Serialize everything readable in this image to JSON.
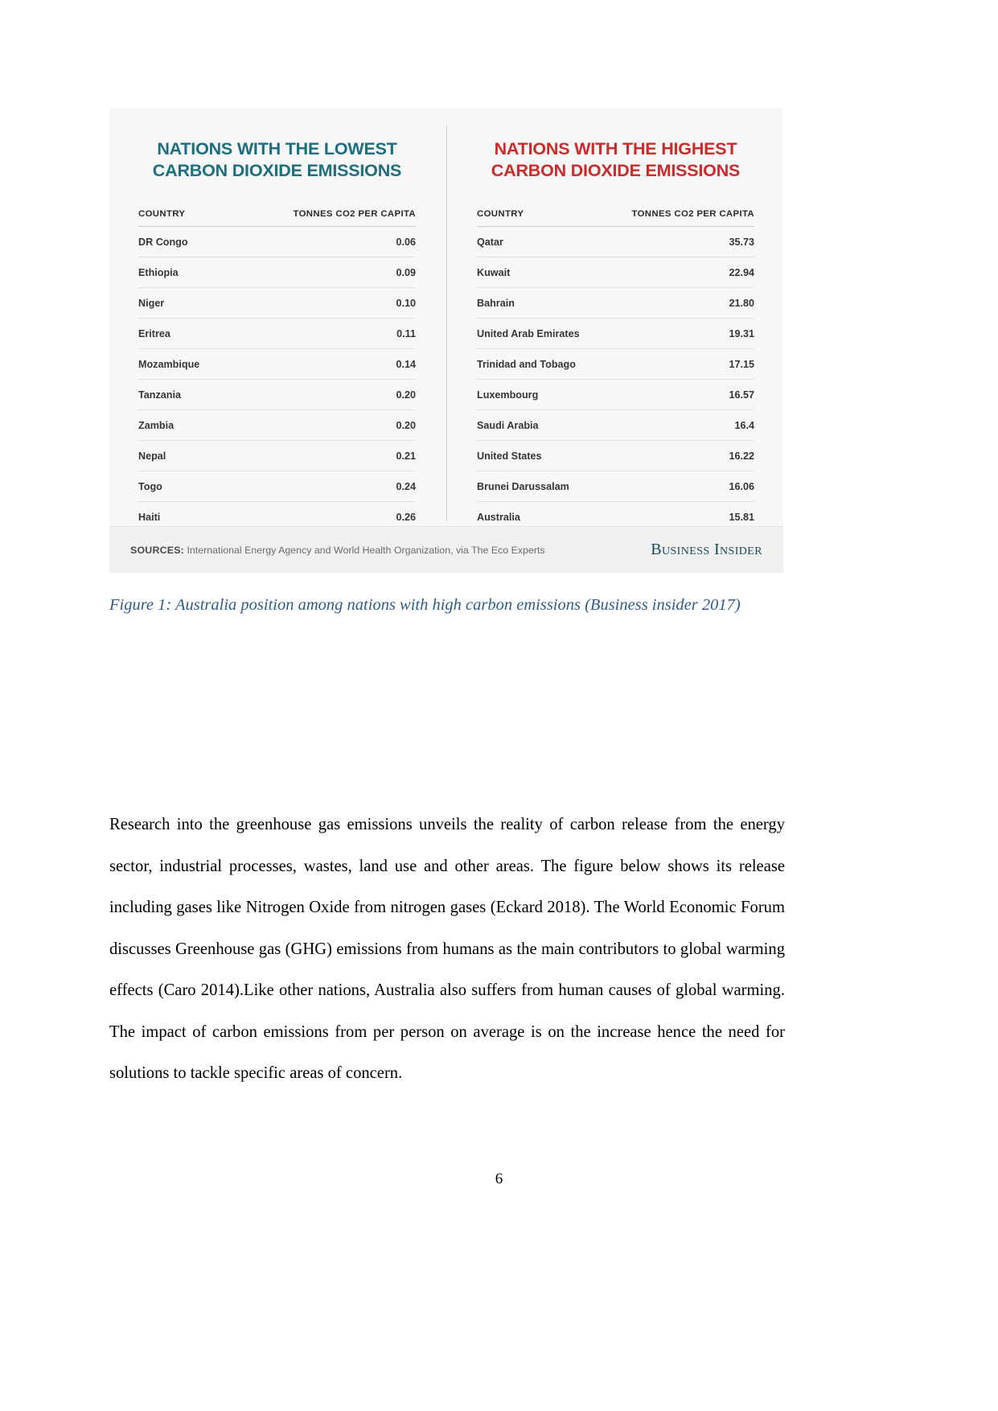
{
  "figure": {
    "left_panel": {
      "title": "NATIONS WITH THE LOWEST\nCARBON DIOXIDE EMISSIONS",
      "title_line1": "NATIONS WITH THE LOWEST",
      "title_line2": "CARBON DIOXIDE EMISSIONS",
      "accent_color": "#1c6e80",
      "columns": [
        "COUNTRY",
        "TONNES CO2 PER CAPITA"
      ],
      "rows": [
        {
          "country": "DR Congo",
          "value": "0.06"
        },
        {
          "country": "Ethiopia",
          "value": "0.09"
        },
        {
          "country": "Niger",
          "value": "0.10"
        },
        {
          "country": "Eritrea",
          "value": "0.11"
        },
        {
          "country": "Mozambique",
          "value": "0.14"
        },
        {
          "country": "Tanzania",
          "value": "0.20"
        },
        {
          "country": "Zambia",
          "value": "0.20"
        },
        {
          "country": "Nepal",
          "value": "0.21"
        },
        {
          "country": "Togo",
          "value": "0.24"
        },
        {
          "country": "Haiti",
          "value": "0.26"
        }
      ]
    },
    "right_panel": {
      "title_line1": "NATIONS WITH THE HIGHEST",
      "title_line2": "CARBON DIOXIDE EMISSIONS",
      "accent_color": "#cc2b2b",
      "columns": [
        "COUNTRY",
        "TONNES CO2 PER CAPITA"
      ],
      "rows": [
        {
          "country": "Qatar",
          "value": "35.73"
        },
        {
          "country": "Kuwait",
          "value": "22.94"
        },
        {
          "country": "Bahrain",
          "value": "21.80"
        },
        {
          "country": "United Arab Emirates",
          "value": "19.31"
        },
        {
          "country": "Trinidad and Tobago",
          "value": "17.15"
        },
        {
          "country": "Luxembourg",
          "value": "16.57"
        },
        {
          "country": "Saudi Arabia",
          "value": "16.4"
        },
        {
          "country": "United States",
          "value": "16.22"
        },
        {
          "country": "Brunei Darussalam",
          "value": "16.06"
        },
        {
          "country": "Australia",
          "value": "15.81"
        }
      ]
    },
    "footer": {
      "sources_label": "SOURCES:",
      "sources_text": " International Energy Agency and World Health Organization, via The Eco Experts",
      "brand": "Business Insider"
    }
  },
  "caption": "Figure 1: Australia position among nations with high carbon emissions (Business insider 2017)",
  "body_paragraph": "Research into the greenhouse gas emissions unveils the reality of carbon release from the energy sector, industrial processes, wastes, land use and other areas. The figure below shows its release including gases like Nitrogen Oxide from nitrogen gases (Eckard 2018). The World Economic Forum discusses Greenhouse gas (GHG) emissions from humans as the main contributors to global warming effects (Caro 2014).Like other nations, Australia also suffers from human causes of global warming. The impact of carbon emissions from per person on average is on the increase hence the need for solutions to tackle specific areas of concern.",
  "page_number": "6",
  "chart_data": {
    "type": "table",
    "title": "Carbon dioxide emissions per capita — lowest and highest emitting nations",
    "xlabel": "",
    "ylabel": "Tonnes CO2 per capita",
    "series": [
      {
        "name": "NATIONS WITH THE LOWEST CARBON DIOXIDE EMISSIONS",
        "categories": [
          "DR Congo",
          "Ethiopia",
          "Niger",
          "Eritrea",
          "Mozambique",
          "Tanzania",
          "Zambia",
          "Nepal",
          "Togo",
          "Haiti"
        ],
        "values": [
          0.06,
          0.09,
          0.1,
          0.11,
          0.14,
          0.2,
          0.2,
          0.21,
          0.24,
          0.26
        ]
      },
      {
        "name": "NATIONS WITH THE HIGHEST CARBON DIOXIDE EMISSIONS",
        "categories": [
          "Qatar",
          "Kuwait",
          "Bahrain",
          "United Arab Emirates",
          "Trinidad and Tobago",
          "Luxembourg",
          "Saudi Arabia",
          "United States",
          "Brunei Darussalam",
          "Australia"
        ],
        "values": [
          35.73,
          22.94,
          21.8,
          19.31,
          17.15,
          16.57,
          16.4,
          16.22,
          16.06,
          15.81
        ]
      }
    ],
    "units": "tonnes CO2 per capita",
    "source": "International Energy Agency and World Health Organization, via The Eco Experts"
  }
}
